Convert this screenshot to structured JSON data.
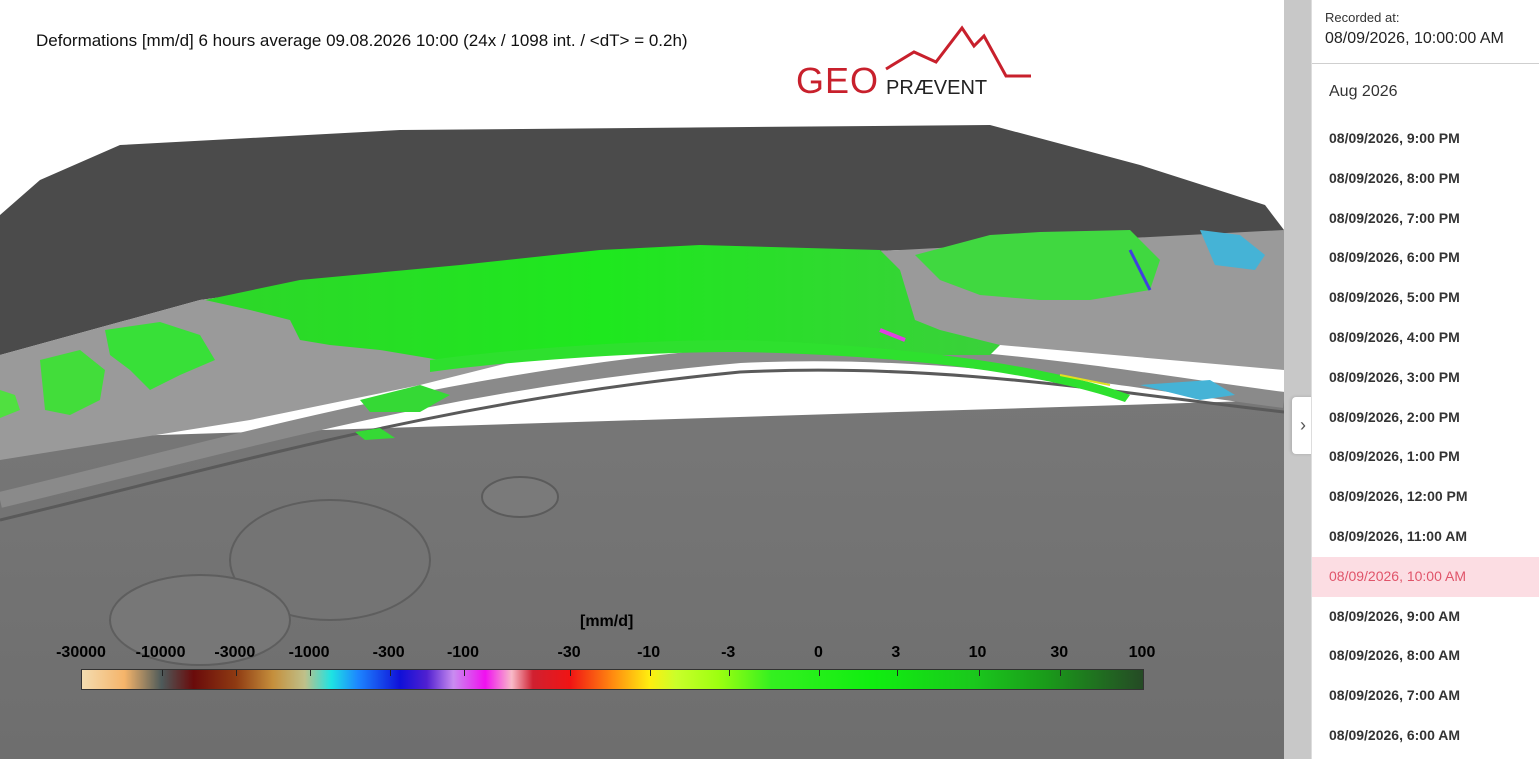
{
  "map": {
    "title": "Deformations [mm/d] 6 hours average 09.08.2026 10:00 (24x / 1098 int. / <dT> = 0.2h)",
    "logo_text": {
      "geo": "GEO",
      "praevent": "PRÆVENT"
    },
    "colors": {
      "logo_red": "#c8202c",
      "logo_dark": "#222222"
    }
  },
  "colorbar": {
    "unit": "[mm/d]",
    "ticks": [
      "-30000",
      "-10000",
      "-3000",
      "-1000",
      "-300",
      "-100",
      "-30",
      "-10",
      "-3",
      "0",
      "3",
      "10",
      "30",
      "100"
    ],
    "tick_positions": [
      0,
      7.5,
      14.5,
      21.5,
      29,
      36,
      46,
      53.5,
      61,
      69.5,
      76.8,
      84.5,
      92.2,
      100
    ]
  },
  "sidebar": {
    "recorded_label": "Recorded at:",
    "recorded_value": "08/09/2026, 10:00:00 AM",
    "month": "Aug 2026",
    "toggle_icon": "chevron-right-icon",
    "items": [
      {
        "label": "08/09/2026, 9:00 PM",
        "selected": false
      },
      {
        "label": "08/09/2026, 8:00 PM",
        "selected": false
      },
      {
        "label": "08/09/2026, 7:00 PM",
        "selected": false
      },
      {
        "label": "08/09/2026, 6:00 PM",
        "selected": false
      },
      {
        "label": "08/09/2026, 5:00 PM",
        "selected": false
      },
      {
        "label": "08/09/2026, 4:00 PM",
        "selected": false
      },
      {
        "label": "08/09/2026, 3:00 PM",
        "selected": false
      },
      {
        "label": "08/09/2026, 2:00 PM",
        "selected": false
      },
      {
        "label": "08/09/2026, 1:00 PM",
        "selected": false
      },
      {
        "label": "08/09/2026, 12:00 PM",
        "selected": false
      },
      {
        "label": "08/09/2026, 11:00 AM",
        "selected": false
      },
      {
        "label": "08/09/2026, 10:00 AM",
        "selected": true
      },
      {
        "label": "08/09/2026, 9:00 AM",
        "selected": false
      },
      {
        "label": "08/09/2026, 8:00 AM",
        "selected": false
      },
      {
        "label": "08/09/2026, 7:00 AM",
        "selected": false
      },
      {
        "label": "08/09/2026, 6:00 AM",
        "selected": false
      }
    ],
    "colors": {
      "selected_bg": "#fcdde3",
      "selected_text": "#e0546a"
    }
  }
}
